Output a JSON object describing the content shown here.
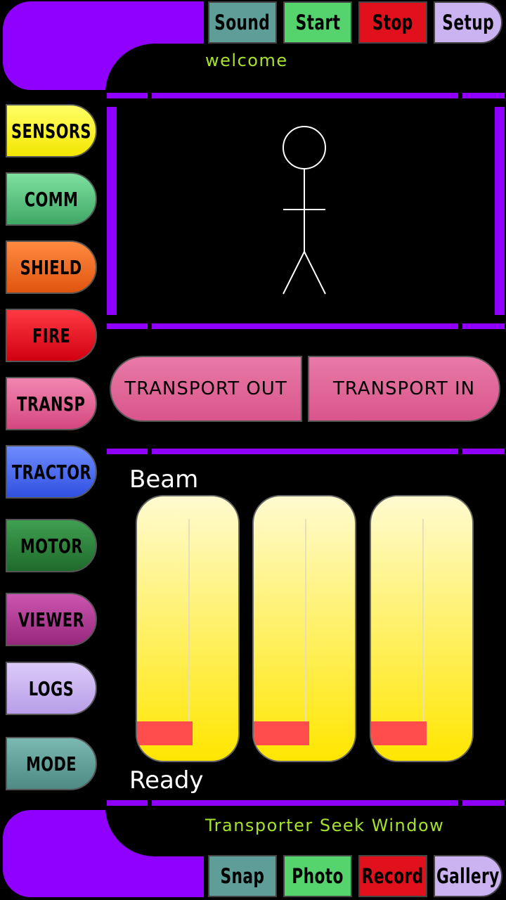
{
  "top_buttons": [
    {
      "label": "Sound",
      "color": "#5f9e98"
    },
    {
      "label": "Start",
      "color": "#55d46e"
    },
    {
      "label": "Stop",
      "color": "#e0101c"
    },
    {
      "label": "Setup",
      "color": "#cbb2f0"
    }
  ],
  "status": {
    "top": "welcome",
    "bottom": "Transporter Seek Window"
  },
  "side_buttons": [
    {
      "label": "SENSORS",
      "color": "#fff500"
    },
    {
      "label": "COMM",
      "color": "#56c27a"
    },
    {
      "label": "SHIELD",
      "color": "#f26a1c"
    },
    {
      "label": "FIRE",
      "color": "#e0101c"
    },
    {
      "label": "TRANSP",
      "color": "#de5a90"
    },
    {
      "label": "TRACTOR",
      "color": "#4a6af0"
    },
    {
      "label": "MOTOR",
      "color": "#2c7d3a"
    },
    {
      "label": "VIEWER",
      "color": "#b13a96"
    },
    {
      "label": "LOGS",
      "color": "#c8b2ef"
    },
    {
      "label": "MODE",
      "color": "#5f9e98"
    }
  ],
  "transport": {
    "out": "TRANSPORT OUT",
    "in": "TRANSPORT IN"
  },
  "beam": {
    "title": "Beam",
    "status": "Ready",
    "levels": [
      0.22,
      0.22,
      0.22
    ]
  },
  "bottom_buttons": [
    {
      "label": "Snap",
      "color": "#5f9e98"
    },
    {
      "label": "Photo",
      "color": "#55d46e"
    },
    {
      "label": "Record",
      "color": "#e0101c"
    },
    {
      "label": "Gallery",
      "color": "#cbb2f0"
    }
  ]
}
